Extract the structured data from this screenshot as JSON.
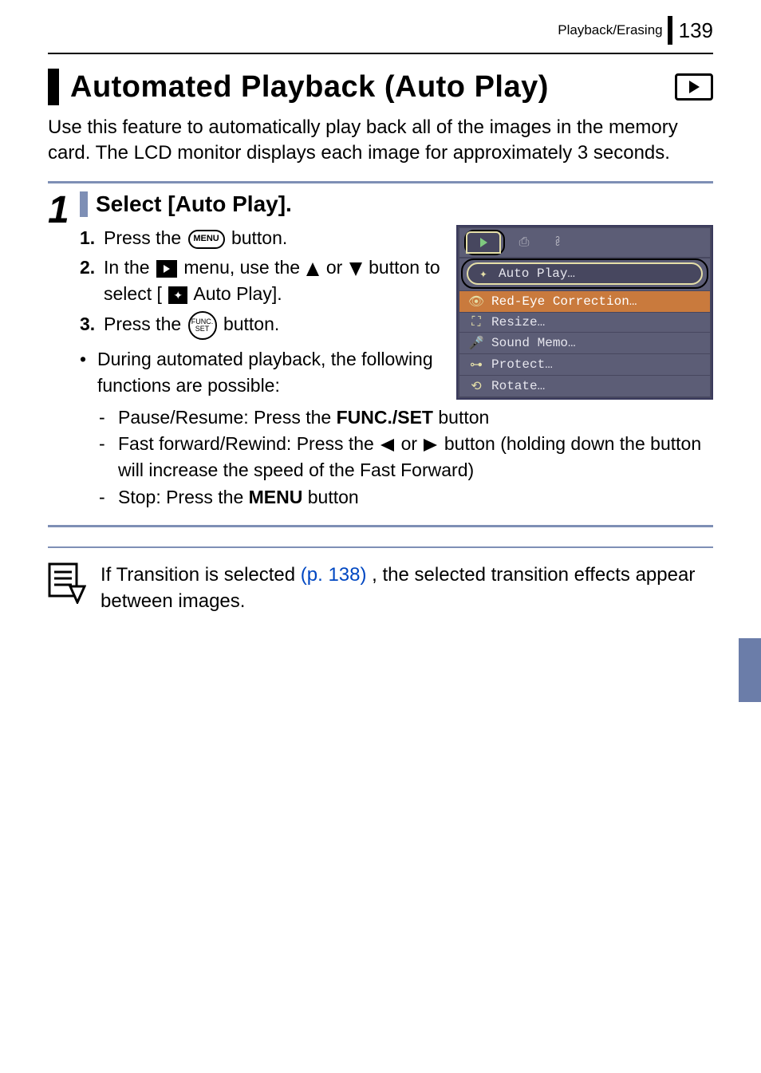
{
  "header": {
    "section": "Playback/Erasing",
    "page": "139"
  },
  "title": "Automated Playback (Auto Play)",
  "intro": "Use this feature to automatically play back all of the images in the memory card. The LCD monitor displays each image for approximately 3 seconds.",
  "step": {
    "num": "1",
    "heading": "Select [Auto Play].",
    "s1_n": "1.",
    "s1_a": "Press the ",
    "s1_b": " button.",
    "s2_n": "2.",
    "s2_a": "In the ",
    "s2_b": " menu, use the ",
    "s2_c": " or ",
    "s2_d": " button to select [",
    "s2_e": " Auto Play].",
    "s3_n": "3.",
    "s3_a": "Press the ",
    "s3_b": " button.",
    "bullet": "During automated playback, the following functions are possible:",
    "d1_a": "Pause/Resume: Press the ",
    "d1_b": "FUNC./SET",
    "d1_c": " button",
    "d2_a": "Fast forward/Rewind: Press the ",
    "d2_b": " or ",
    "d2_c": " button (holding down the button will increase the speed of the Fast Forward)",
    "d3_a": "Stop: Press the ",
    "d3_b": "MENU",
    "d3_c": " button"
  },
  "menu": {
    "items": [
      "Auto Play…",
      "Red-Eye Correction…",
      "Resize…",
      "Sound Memo…",
      "Protect…",
      "Rotate…"
    ]
  },
  "note": {
    "a": "If Transition is selected ",
    "link": "(p. 138)",
    "b": ", the selected transition effects appear between images."
  }
}
